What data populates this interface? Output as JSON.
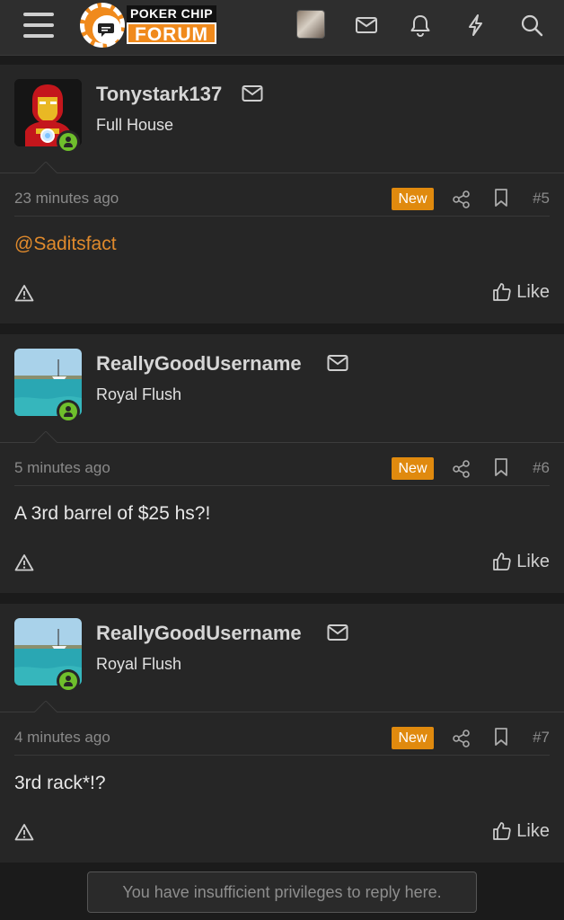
{
  "header": {
    "logo_top": "POKER CHIP",
    "logo_bottom": "FORUM",
    "icons": [
      "menu-icon",
      "avatar",
      "envelope-icon",
      "bell-icon",
      "bolt-icon",
      "search-icon"
    ]
  },
  "posts": [
    {
      "username": "Tonystark137",
      "user_title": "Full House",
      "time": "23 minutes ago",
      "badge": "New",
      "number": "#5",
      "content": "@Saditsfact",
      "content_is_mention": true,
      "like_label": "Like",
      "avatar": "iron-man-avatar"
    },
    {
      "username": "ReallyGoodUsername",
      "user_title": "Royal Flush",
      "time": "5 minutes ago",
      "badge": "New",
      "number": "#6",
      "content": "A 3rd barrel of $25 hs?!",
      "content_is_mention": false,
      "like_label": "Like",
      "avatar": "boat-sea-avatar"
    },
    {
      "username": "ReallyGoodUsername",
      "user_title": "Royal Flush",
      "time": "4 minutes ago",
      "badge": "New",
      "number": "#7",
      "content": "3rd rack*!?",
      "content_is_mention": false,
      "like_label": "Like",
      "avatar": "boat-sea-avatar"
    }
  ],
  "footer": {
    "notice": "You have insufficient privileges to reply here."
  },
  "colors": {
    "accent": "#e08a0e",
    "mention": "#e08a2c",
    "online": "#6fbf2c",
    "background": "#1b1b1b",
    "panel": "#262626"
  }
}
